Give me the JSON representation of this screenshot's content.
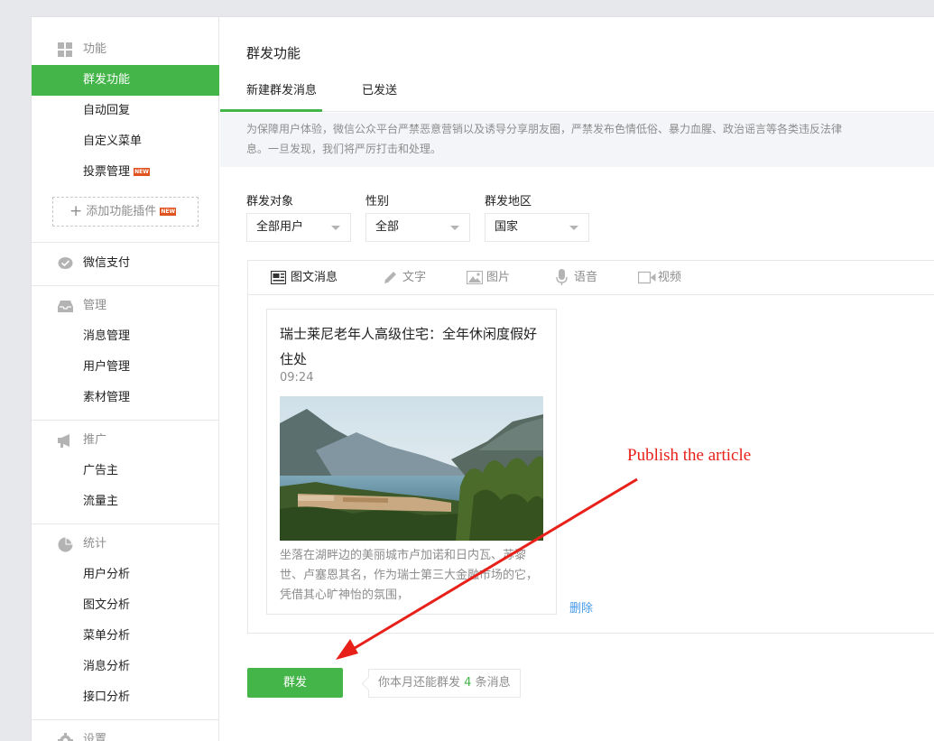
{
  "sidebar": {
    "groups": [
      {
        "label": "功能",
        "icon": "grid-icon",
        "items": [
          {
            "label": "群发功能",
            "active": true
          },
          {
            "label": "自动回复"
          },
          {
            "label": "自定义菜单"
          },
          {
            "label": "投票管理",
            "badge": "NEW"
          }
        ],
        "add_plugin": {
          "label": "添加功能插件",
          "badge": "NEW"
        }
      },
      {
        "label": "微信支付",
        "icon": "wechat-pay-icon",
        "items": []
      },
      {
        "label": "管理",
        "icon": "inbox-icon",
        "items": [
          {
            "label": "消息管理"
          },
          {
            "label": "用户管理"
          },
          {
            "label": "素材管理"
          }
        ]
      },
      {
        "label": "推广",
        "icon": "megaphone-icon",
        "items": [
          {
            "label": "广告主"
          },
          {
            "label": "流量主"
          }
        ]
      },
      {
        "label": "统计",
        "icon": "pie-chart-icon",
        "items": [
          {
            "label": "用户分析"
          },
          {
            "label": "图文分析"
          },
          {
            "label": "菜单分析"
          },
          {
            "label": "消息分析"
          },
          {
            "label": "接口分析"
          }
        ]
      },
      {
        "label": "设置",
        "icon": "gear-icon",
        "items": []
      }
    ]
  },
  "main": {
    "title": "群发功能",
    "tabs": [
      {
        "label": "新建群发消息",
        "active": true
      },
      {
        "label": "已发送"
      }
    ],
    "notice": {
      "line1": "为保障用户体验，微信公众平台严禁恶意营销以及诱导分享朋友圈，严禁发布色情低俗、暴力血腥、政治谣言等各类违反法律",
      "line2": "息。一旦发现，我们将严厉打击和处理。"
    },
    "filters": [
      {
        "label": "群发对象",
        "value": "全部用户"
      },
      {
        "label": "性别",
        "value": "全部"
      },
      {
        "label": "群发地区",
        "value": "国家"
      }
    ],
    "editor_tabs": [
      {
        "label": "图文消息",
        "icon": "news-icon",
        "active": true
      },
      {
        "label": "文字",
        "icon": "pencil-icon"
      },
      {
        "label": "图片",
        "icon": "image-icon"
      },
      {
        "label": "语音",
        "icon": "microphone-icon"
      },
      {
        "label": "视频",
        "icon": "video-icon"
      }
    ],
    "article": {
      "title": "瑞士莱尼老年人高级住宅：全年休闲度假好住处",
      "time": "09:24",
      "digest": "坐落在湖畔边的美丽城市卢加诺和日内瓦、苏黎世、卢塞恩其名，作为瑞士第三大金融市场的它，凭借其心旷神怡的氛围，",
      "delete_label": "删除"
    },
    "send_button": "群发",
    "quota_tip": {
      "prefix": "你本月还能群发",
      "count": "4",
      "suffix": "条消息"
    }
  },
  "annotation": {
    "text": "Publish the article",
    "color": "#e8201a"
  },
  "colors": {
    "accent": "#44b549",
    "link": "#459ae9",
    "muted": "#8d8d8d"
  }
}
